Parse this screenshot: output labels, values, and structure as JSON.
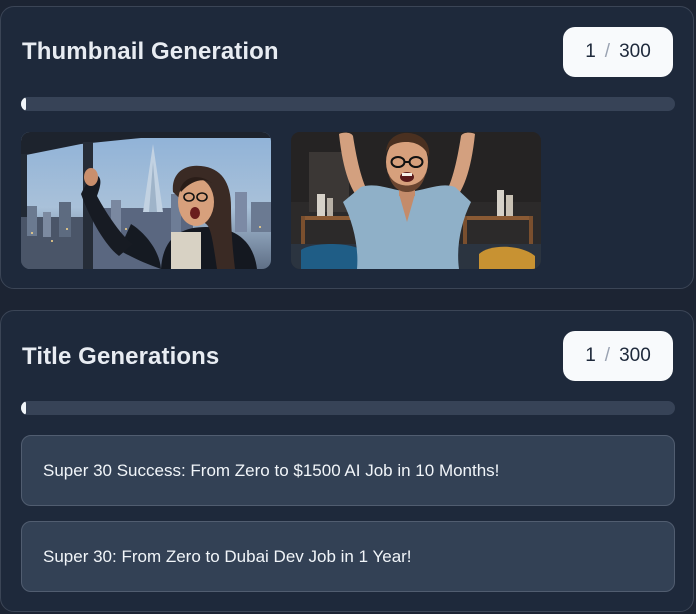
{
  "thumbnail_section": {
    "title": "Thumbnail Generation",
    "counter": {
      "current": "1",
      "separator": "/",
      "total": "300"
    },
    "progress_fraction": 0.0033,
    "images": [
      {
        "description_icon": "photo-woman-celebrating-city-view"
      },
      {
        "description_icon": "photo-man-celebrating-arms-raised"
      }
    ]
  },
  "title_section": {
    "title": "Title Generations",
    "counter": {
      "current": "1",
      "separator": "/",
      "total": "300"
    },
    "progress_fraction": 0.0033,
    "items": [
      {
        "text": "Super 30 Success: From Zero to $1500 AI Job in 10 Months!"
      },
      {
        "text": "Super 30: From Zero to Dubai Dev Job in 1 Year!"
      }
    ]
  },
  "colors": {
    "background": "#1c2433",
    "card": "#1e293b",
    "accent_light": "#f8fafc",
    "progress_track": "#374357",
    "title_item": "#334155"
  }
}
